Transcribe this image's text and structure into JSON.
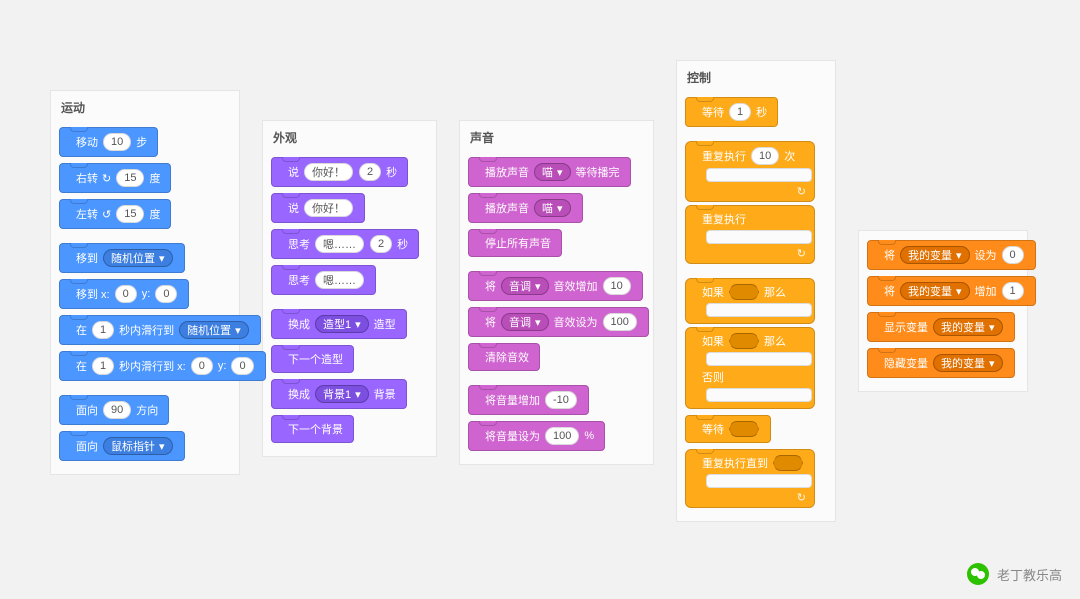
{
  "footer": {
    "text": "老丁教乐高"
  },
  "motion": {
    "title": "运动",
    "move_a": "移动",
    "move_b": "步",
    "move_v": "10",
    "turnR_a": "右转",
    "turnR_b": "度",
    "turnR_v": "15",
    "turnL_a": "左转",
    "turnL_b": "度",
    "turnL_v": "15",
    "goto_a": "移到",
    "goto_drop": "随机位置",
    "gotoxy_a": "移到 x:",
    "gotoxy_x": "0",
    "gotoxy_b": "y:",
    "gotoxy_y": "0",
    "glide_a": "在",
    "glide_v": "1",
    "glide_b": "秒内滑行到",
    "glide_drop": "随机位置",
    "glidexy_a": "在",
    "glidexy_v": "1",
    "glidexy_b": "秒内滑行到 x:",
    "glidexy_x": "0",
    "glidexy_c": "y:",
    "glidexy_y": "0",
    "point_a": "面向",
    "point_v": "90",
    "point_b": "方向",
    "point2_a": "面向",
    "point2_drop": "鼠标指针"
  },
  "looks": {
    "title": "外观",
    "say1_a": "说",
    "say1_v": "你好！",
    "say1_b": "",
    "say1_t": "2",
    "say1_c": "秒",
    "say2_a": "说",
    "say2_v": "你好！",
    "think1_a": "思考",
    "think1_v": "嗯……",
    "think1_t": "2",
    "think1_c": "秒",
    "think2_a": "思考",
    "think2_v": "嗯……",
    "sw1_a": "换成",
    "sw1_drop": "造型1",
    "sw1_b": "造型",
    "next1": "下一个造型",
    "sw2_a": "换成",
    "sw2_drop": "背景1",
    "sw2_b": "背景",
    "next2": "下一个背景"
  },
  "sound": {
    "title": "声音",
    "play1_a": "播放声音",
    "play1_drop": "喵",
    "play1_b": "等待播完",
    "play2_a": "播放声音",
    "play2_drop": "喵",
    "stop": "停止所有声音",
    "fx1_a": "将",
    "fx1_drop": "音调",
    "fx1_b": "音效增加",
    "fx1_v": "10",
    "fx2_a": "将",
    "fx2_drop": "音调",
    "fx2_b": "音效设为",
    "fx2_v": "100",
    "clear": "清除音效",
    "vol1_a": "将音量增加",
    "vol1_v": "-10",
    "vol2_a": "将音量设为",
    "vol2_v": "100",
    "vol2_b": "%"
  },
  "ctrl": {
    "title": "控制",
    "wait_a": "等待",
    "wait_v": "1",
    "wait_b": "秒",
    "repeat_a": "重复执行",
    "repeat_v": "10",
    "repeat_b": "次",
    "forever": "重复执行",
    "if_a": "如果",
    "if_b": "那么",
    "else_a": "如果",
    "else_b": "那么",
    "else_c": "否则",
    "waitu": "等待",
    "repu": "重复执行直到"
  },
  "data": {
    "set_a": "将",
    "set_drop": "我的变量",
    "set_b": "设为",
    "set_v": "0",
    "chg_a": "将",
    "chg_drop": "我的变量",
    "chg_b": "增加",
    "chg_v": "1",
    "show_a": "显示变量",
    "show_drop": "我的变量",
    "hide_a": "隐藏变量",
    "hide_drop": "我的变量"
  }
}
